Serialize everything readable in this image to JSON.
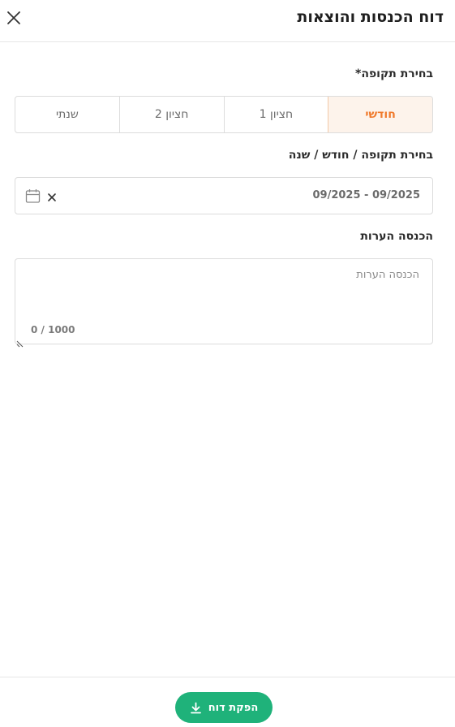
{
  "header": {
    "title": "דוח הכנסות והוצאות",
    "close_icon": "close-icon"
  },
  "period": {
    "label": "בחירת תקופה*",
    "options": [
      "חודשי",
      "חציון 1",
      "חציון 2",
      "שנתי"
    ],
    "selected": "חודשי",
    "accent_color": "#f07a2c"
  },
  "date_range": {
    "label": "בחירת תקופה / חודש / שנה",
    "value": "09/2025 - 09/2025",
    "calendar_icon": "calendar-icon",
    "clear_icon": "clear-icon"
  },
  "notes": {
    "label": "הכנסה הערות",
    "placeholder": "הכנסה הערות",
    "value": "",
    "counter": "0 / 1000"
  },
  "footer": {
    "submit_label": "הפקת דוח",
    "submit_icon": "download-icon",
    "button_color": "#1fb27a"
  }
}
